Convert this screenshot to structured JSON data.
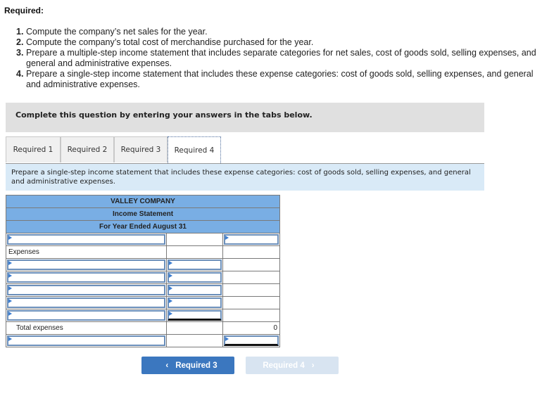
{
  "required_heading": "Required:",
  "requirements": [
    {
      "num": "1.",
      "text": "Compute the company’s net sales for the year."
    },
    {
      "num": "2.",
      "text": "Compute the company’s total cost of merchandise purchased for the year."
    },
    {
      "num": "3.",
      "text": "Prepare a multiple-step income statement that includes separate categories for net sales, cost of goods sold, selling expenses, and general and administrative expenses."
    },
    {
      "num": "4.",
      "text": "Prepare a single-step income statement that includes these expense categories: cost of goods sold, selling expenses, and general and administrative expenses."
    }
  ],
  "instruction": "Complete this question by entering your answers in the tabs below.",
  "tabs": [
    {
      "label": "Required 1",
      "active": false
    },
    {
      "label": "Required 2",
      "active": false
    },
    {
      "label": "Required 3",
      "active": false
    },
    {
      "label": "Required 4",
      "active": true
    }
  ],
  "task_text": "Prepare a single-step income statement that includes these expense categories: cost of goods sold, selling expenses, and general and administrative expenses.",
  "statement": {
    "company": "VALLEY COMPANY",
    "title": "Income Statement",
    "period": "For Year Ended August 31",
    "expenses_label": "Expenses",
    "total_expenses_label": "Total expenses",
    "total_expenses_value": "0",
    "inputs": {
      "revenue_label": "",
      "revenue_amount": "",
      "expense_rows": [
        {
          "label": "",
          "amount": ""
        },
        {
          "label": "",
          "amount": ""
        },
        {
          "label": "",
          "amount": ""
        },
        {
          "label": "",
          "amount": ""
        },
        {
          "label": "",
          "amount": ""
        }
      ],
      "net_label": "",
      "net_amount": ""
    }
  },
  "nav": {
    "prev_label": "Required 3",
    "next_label": "Required 4",
    "prev_icon": "chevron-left-icon",
    "next_icon": "chevron-right-icon"
  },
  "colors": {
    "header_blue": "#79aee4",
    "task_panel": "#d9eaf7",
    "button_blue": "#3b77bf",
    "button_disabled": "#d8e4f1"
  }
}
